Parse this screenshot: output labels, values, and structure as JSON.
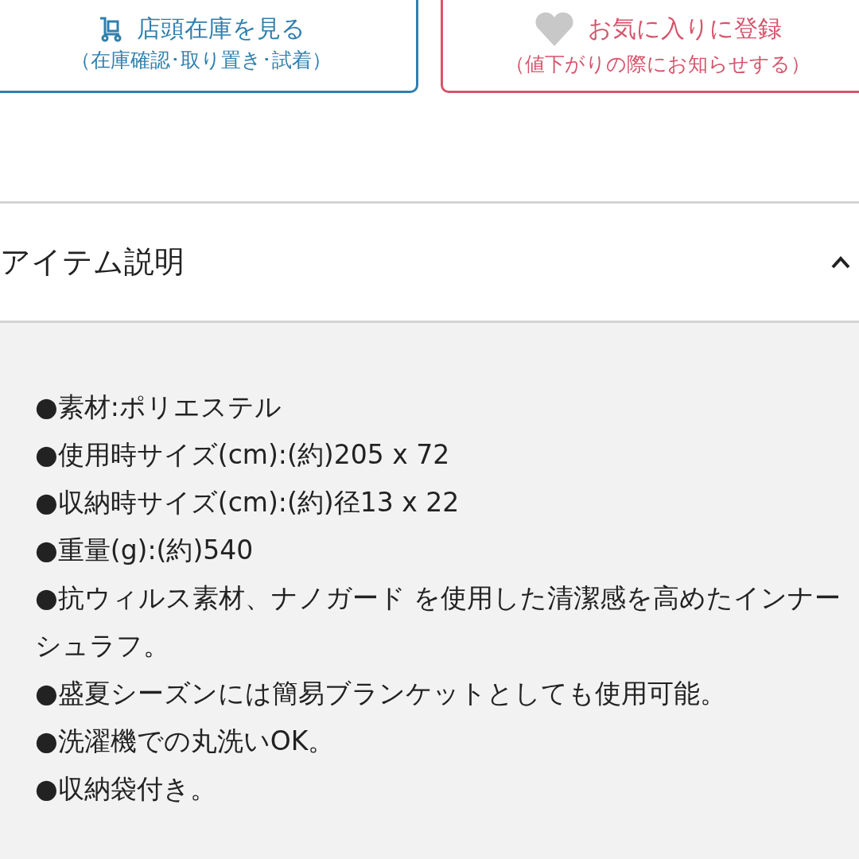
{
  "actions": [
    {
      "kind": "store",
      "title": "店頭在庫を見る",
      "subtitle": "（在庫確認･取り置き･試着）"
    },
    {
      "kind": "favorite",
      "title": "お気に入りに登録",
      "subtitle": "（値下がりの際にお知らせする）"
    }
  ],
  "section": {
    "title": "アイテム説明",
    "expanded": true,
    "items": [
      "●素材:ポリエステル",
      "●使用時サイズ(cm):(約)205 x 72",
      "●収納時サイズ(cm):(約)径13 x 22",
      "●重量(g):(約)540",
      "●抗ウィルス素材、ナノガード を使用した清潔感を高めたインナーシュラフ。",
      "●盛夏シーズンには簡易ブランケットとしても使用可能。",
      "●洗濯機での丸洗いOK。",
      "●収納袋付き。"
    ]
  }
}
